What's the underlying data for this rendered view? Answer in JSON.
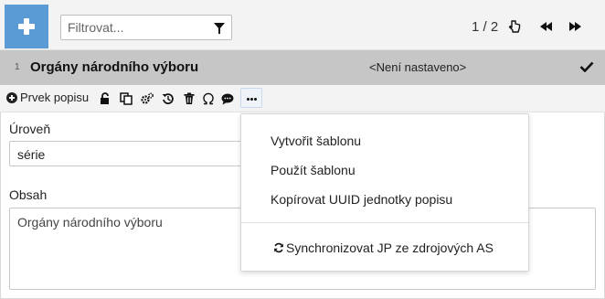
{
  "toolbar_top": {
    "add_button": "+",
    "filter_placeholder": "Filtrovat...",
    "pager": "1 / 2"
  },
  "header": {
    "number": "1",
    "title": "Orgány národního výboru",
    "state": "<Není nastaveno>"
  },
  "toolbar": {
    "add_element_label": "Prvek popisu",
    "icons": [
      "lock-icon",
      "copy-icon",
      "settings-icon",
      "history-icon",
      "trash-icon",
      "omega-icon",
      "comment-icon",
      "more-icon"
    ]
  },
  "form": {
    "level_label": "Úroveň",
    "level_value": "série",
    "content_label": "Obsah",
    "content_value": "Orgány národního výboru"
  },
  "menu": {
    "items": [
      "Vytvořit šablonu",
      "Použít šablonu",
      "Kopírovat UUID jednotky popisu"
    ],
    "sync_item": "Synchronizovat JP ze zdrojových AS"
  },
  "colors": {
    "accent": "#5b9bd5",
    "header_bg": "#c6c6c6",
    "toolbar_bg": "#f3f3f3"
  }
}
